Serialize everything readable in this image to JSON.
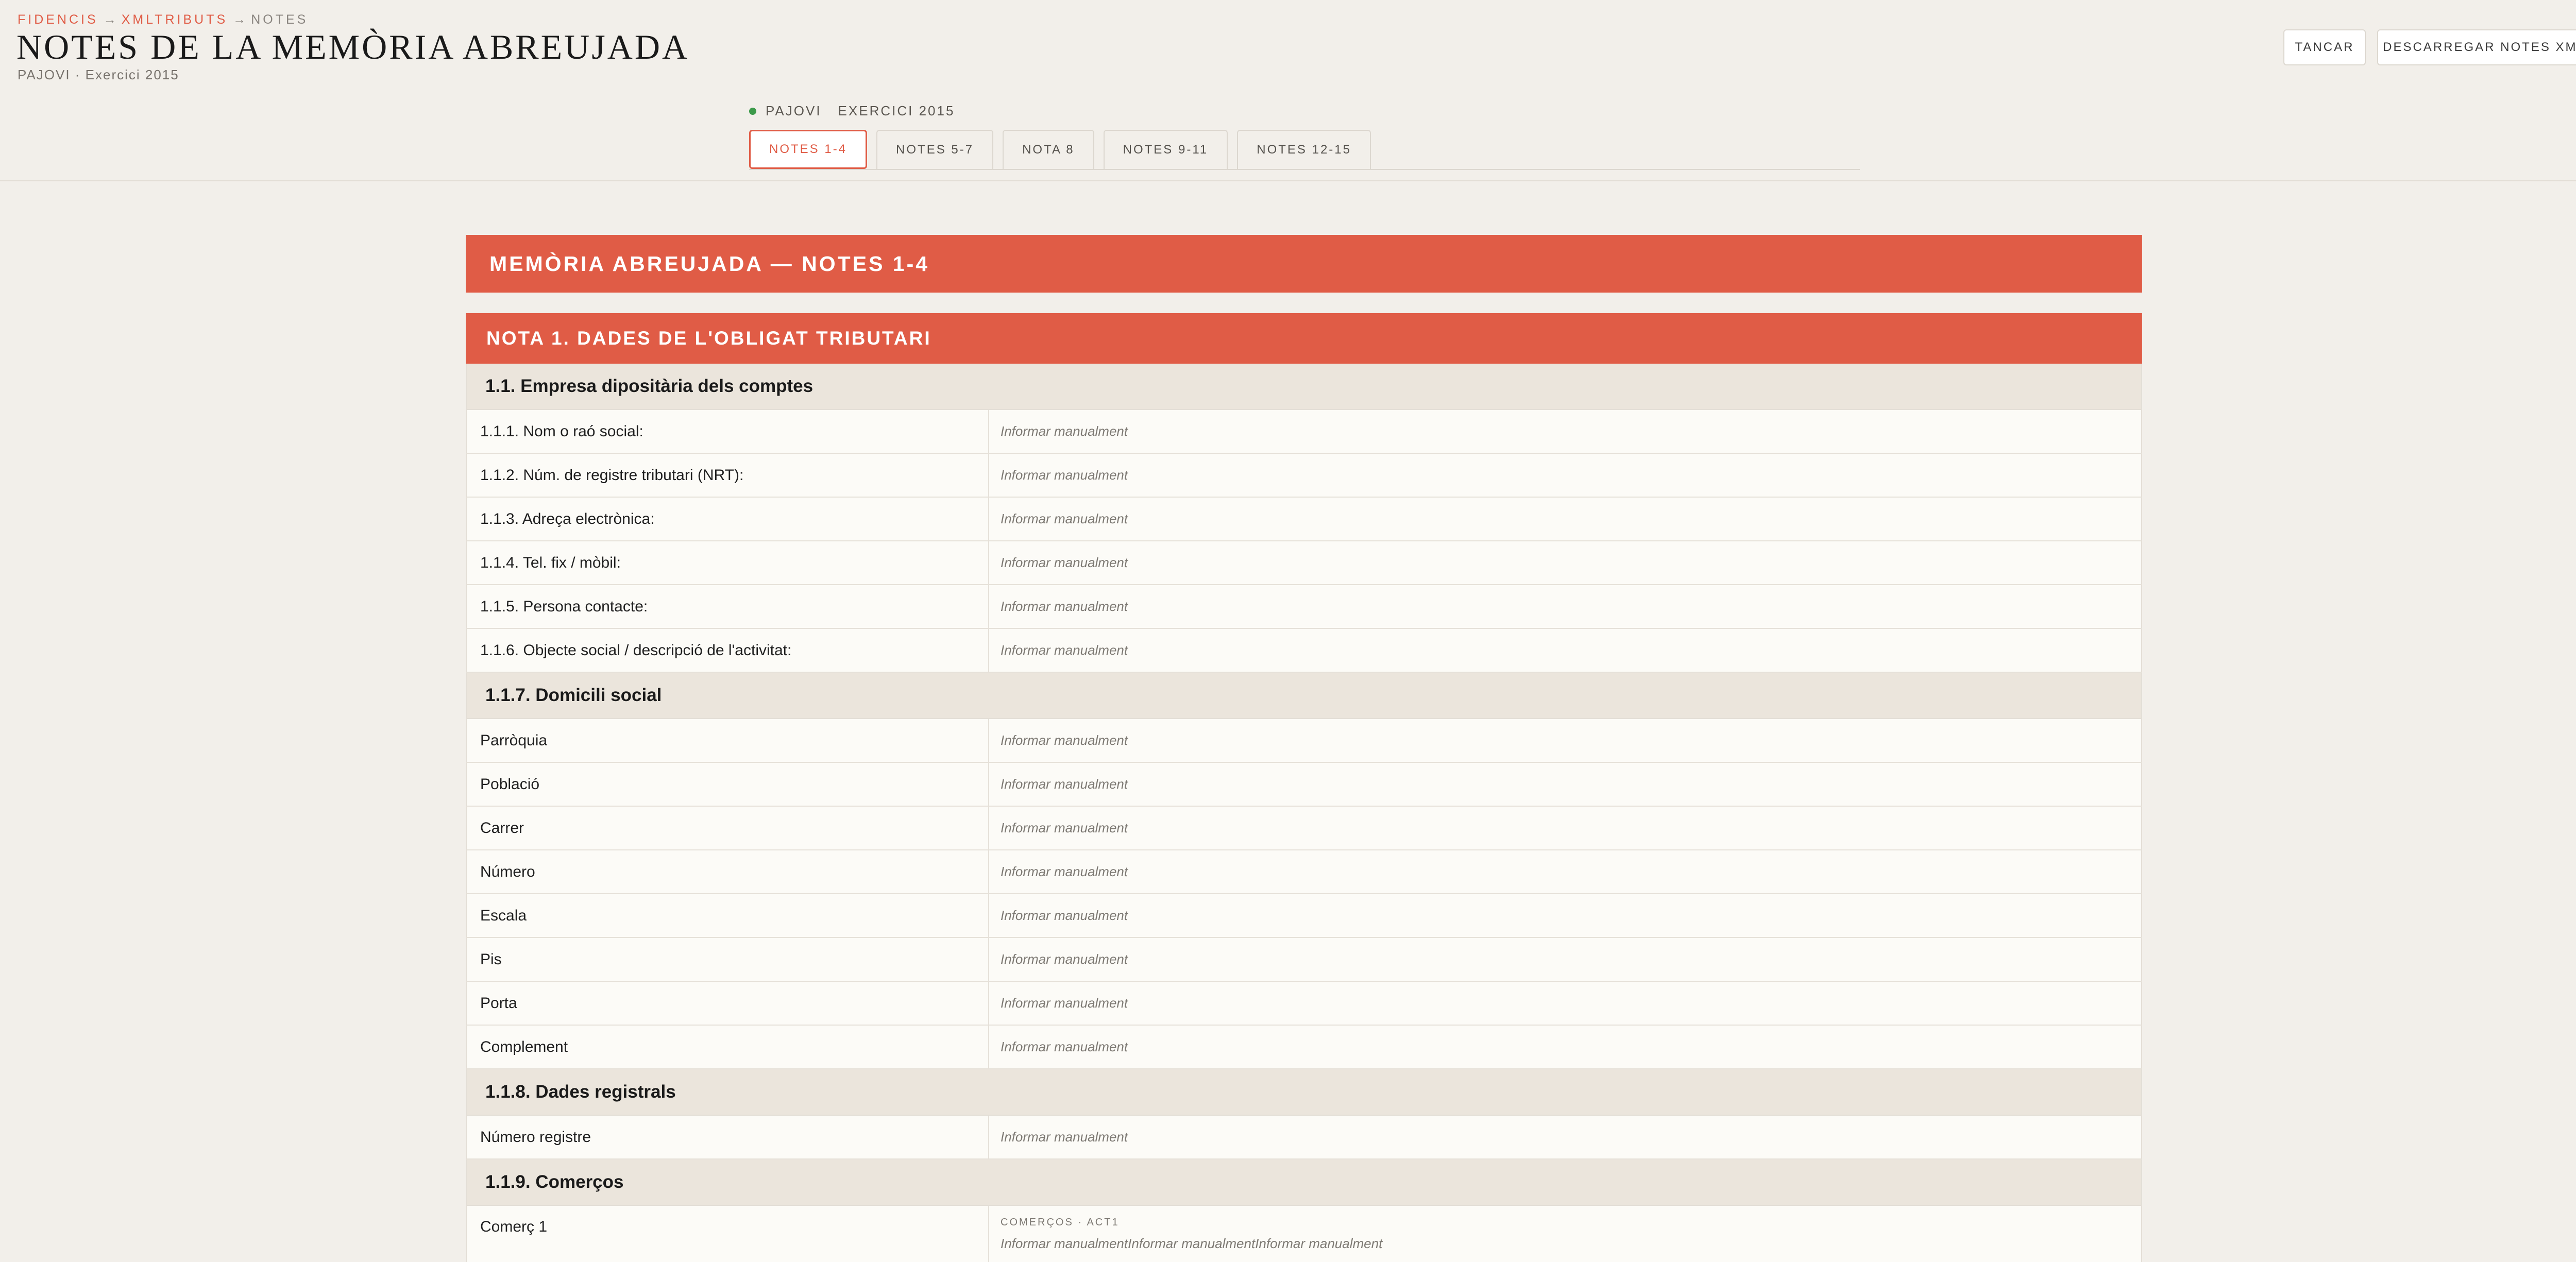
{
  "header": {
    "breadcrumb": {
      "items": [
        "FIDENCIS",
        "XMLTRIBUTS",
        "NOTES"
      ],
      "separator": "→"
    },
    "title": "NOTES DE LA MEMÒRIA ABREUJADA",
    "subtitle": "PAJOVI · Exercici 2015",
    "buttons": {
      "close_label": "TANCAR",
      "download_label": "DESCARREGAR NOTES XML"
    }
  },
  "company": {
    "status_color": "#3c9a4a",
    "name": "PAJOVI",
    "exercise": "EXERCICI 2015"
  },
  "tabs": [
    {
      "label": "NOTES 1-4",
      "active": true
    },
    {
      "label": "NOTES 5-7",
      "active": false
    },
    {
      "label": "NOTA 8",
      "active": false
    },
    {
      "label": "NOTES 9-11",
      "active": false
    },
    {
      "label": "NOTES 12-15",
      "active": false
    }
  ],
  "colors": {
    "accent": "#e05c46",
    "section_bg": "#ebe5dc",
    "page_bg": "#f2efea"
  },
  "form": {
    "banner": "MEMÒRIA ABREUJADA — NOTES 1-4",
    "note_title": "NOTA 1. DADES DE L'OBLIGAT TRIBUTARI",
    "placeholder": "Informar manualment",
    "sections": {
      "s1": {
        "title": "1.1. Empresa dipositària dels comptes",
        "fields": [
          "1.1.1. Nom o raó social:",
          "1.1.2. Núm. de registre tributari (NRT):",
          "1.1.3. Adreça electrònica:",
          "1.1.4. Tel. fix / mòbil:",
          "1.1.5. Persona contacte:",
          "1.1.6. Objecte social / descripció de l'activitat:"
        ]
      },
      "s2": {
        "title": "1.1.7. Domicili social",
        "fields": [
          "Parròquia",
          "Població",
          "Carrer",
          "Número",
          "Escala",
          "Pis",
          "Porta",
          "Complement"
        ]
      },
      "s3": {
        "title": "1.1.8. Dades registrals",
        "fields": [
          "Número registre"
        ]
      },
      "s4": {
        "title": "1.1.9. Comerços",
        "fields": [
          "Comerç 1"
        ],
        "comerc1_sub_label": "COMERÇOS · ACT1",
        "comerc1_value": "Informar manualmentInformar manualmentInformar manualment"
      }
    }
  }
}
